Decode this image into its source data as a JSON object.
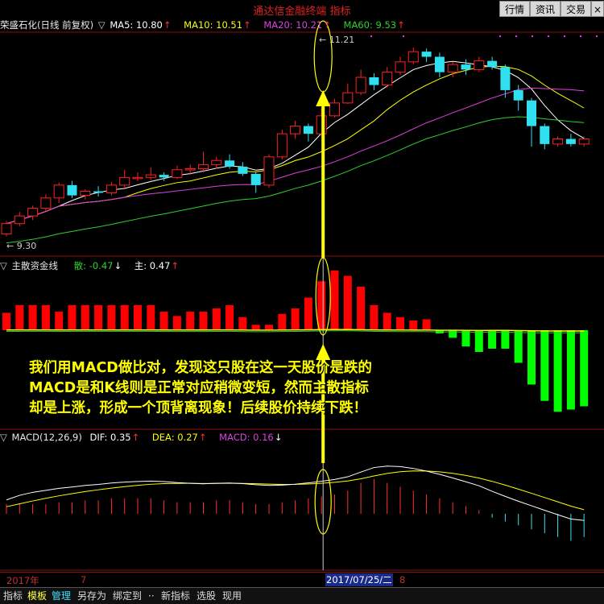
{
  "app": {
    "title": "通达信金融终端 指标"
  },
  "top_buttons": [
    "行情",
    "资讯",
    "交易"
  ],
  "panel_price": {
    "stock": "荣盛石化(日线 前复权)",
    "indicators": [
      {
        "label": "MA5: 10.80",
        "arrow": "↑",
        "color": "#ffffff"
      },
      {
        "label": "MA10: 10.51",
        "arrow": "↑",
        "color": "#ffff00"
      },
      {
        "label": "MA20: 10.21",
        "arrow": "↑",
        "color": "#e040e0"
      },
      {
        "label": "MA60: 9.53",
        "arrow": "↑",
        "color": "#30d030"
      }
    ],
    "high_label": "11.21",
    "low_label": "9.30"
  },
  "panel_fund": {
    "name": "主散资金线",
    "values": [
      {
        "label": "散: -0.47",
        "arrow": "↓",
        "color": "#30d030"
      },
      {
        "label": "主: 0.47",
        "arrow": "↑",
        "color": "#ffffff"
      }
    ]
  },
  "panel_macd": {
    "name": "MACD(12,26,9)",
    "values": [
      {
        "label": "DIF: 0.35",
        "arrow": "↑",
        "color": "#ffffff"
      },
      {
        "label": "DEA: 0.27",
        "arrow": "↑",
        "color": "#ffff00"
      },
      {
        "label": "MACD: 0.16",
        "arrow": "↓",
        "color": "#e040e0"
      }
    ]
  },
  "annotation": {
    "lines": [
      "我们用MACD做比对，发现这只股在这一天股价是跌的",
      "MACD是和K线则是正常对应稍微变短，然而主散指标",
      "却是上涨，形成一个顶背离现象！后续股价持续下跌！"
    ]
  },
  "timeline": {
    "year": "2017年",
    "m7": "7",
    "date": "2017/07/25/二",
    "m8": "8"
  },
  "bottom_tabs": [
    "指标",
    "模板",
    "管理",
    "另存为",
    "绑定到",
    "··",
    "新指标",
    "选股",
    "现用"
  ],
  "colors": {
    "up": "#ff2020",
    "down": "#30e0f0",
    "fund_up": "#ff0000",
    "fund_down": "#00ff00",
    "highlight": "#ffff00"
  },
  "chart_data": {
    "type": "candlestick",
    "candles": [
      {
        "o": 9.35,
        "c": 9.55,
        "h": 9.6,
        "l": 9.3
      },
      {
        "o": 9.55,
        "c": 9.7,
        "h": 9.78,
        "l": 9.5
      },
      {
        "o": 9.7,
        "c": 9.85,
        "h": 9.9,
        "l": 9.62
      },
      {
        "o": 9.85,
        "c": 10.05,
        "h": 10.12,
        "l": 9.8
      },
      {
        "o": 10.05,
        "c": 10.3,
        "h": 10.35,
        "l": 9.95
      },
      {
        "o": 10.3,
        "c": 10.1,
        "h": 10.38,
        "l": 10.05
      },
      {
        "o": 10.1,
        "c": 10.18,
        "h": 10.22,
        "l": 10.02
      },
      {
        "o": 10.18,
        "c": 10.15,
        "h": 10.28,
        "l": 10.08
      },
      {
        "o": 10.15,
        "c": 10.3,
        "h": 10.36,
        "l": 10.1
      },
      {
        "o": 10.3,
        "c": 10.45,
        "h": 10.6,
        "l": 10.25
      },
      {
        "o": 10.45,
        "c": 10.45,
        "h": 10.55,
        "l": 10.38
      },
      {
        "o": 10.45,
        "c": 10.5,
        "h": 10.65,
        "l": 10.4
      },
      {
        "o": 10.5,
        "c": 10.45,
        "h": 10.55,
        "l": 10.38
      },
      {
        "o": 10.45,
        "c": 10.6,
        "h": 10.68,
        "l": 10.42
      },
      {
        "o": 10.6,
        "c": 10.62,
        "h": 10.7,
        "l": 10.5
      },
      {
        "o": 10.62,
        "c": 10.7,
        "h": 10.95,
        "l": 10.55
      },
      {
        "o": 10.7,
        "c": 10.78,
        "h": 10.85,
        "l": 10.62
      },
      {
        "o": 10.78,
        "c": 10.66,
        "h": 10.9,
        "l": 10.62
      },
      {
        "o": 10.66,
        "c": 10.52,
        "h": 10.75,
        "l": 10.48
      },
      {
        "o": 10.52,
        "c": 10.3,
        "h": 10.55,
        "l": 10.15
      },
      {
        "o": 10.3,
        "c": 10.85,
        "h": 10.9,
        "l": 10.25
      },
      {
        "o": 10.85,
        "c": 11.3,
        "h": 11.38,
        "l": 10.8
      },
      {
        "o": 11.3,
        "c": 11.45,
        "h": 11.55,
        "l": 11.2
      },
      {
        "o": 11.45,
        "c": 11.3,
        "h": 11.5,
        "l": 11.15
      },
      {
        "o": 11.3,
        "c": 11.65,
        "h": 11.8,
        "l": 11.28
      },
      {
        "o": 11.65,
        "c": 11.9,
        "h": 11.98,
        "l": 11.62
      },
      {
        "o": 11.9,
        "c": 12.1,
        "h": 12.28,
        "l": 11.88
      },
      {
        "o": 12.1,
        "c": 12.4,
        "h": 12.55,
        "l": 12.05
      },
      {
        "o": 12.4,
        "c": 12.25,
        "h": 12.48,
        "l": 12.15
      },
      {
        "o": 12.25,
        "c": 12.5,
        "h": 12.6,
        "l": 12.2
      },
      {
        "o": 12.5,
        "c": 12.7,
        "h": 12.8,
        "l": 12.45
      },
      {
        "o": 12.7,
        "c": 12.9,
        "h": 12.98,
        "l": 12.65
      },
      {
        "o": 12.9,
        "c": 12.8,
        "h": 12.96,
        "l": 12.7
      },
      {
        "o": 12.8,
        "c": 12.5,
        "h": 12.88,
        "l": 12.4
      },
      {
        "o": 12.5,
        "c": 12.65,
        "h": 12.7,
        "l": 12.4
      },
      {
        "o": 12.65,
        "c": 12.55,
        "h": 12.75,
        "l": 12.45
      },
      {
        "o": 12.55,
        "c": 12.72,
        "h": 12.8,
        "l": 12.5
      },
      {
        "o": 12.72,
        "c": 12.6,
        "h": 12.8,
        "l": 12.55
      },
      {
        "o": 12.6,
        "c": 12.15,
        "h": 12.65,
        "l": 12.0
      },
      {
        "o": 12.15,
        "c": 11.95,
        "h": 12.25,
        "l": 11.75
      },
      {
        "o": 11.95,
        "c": 11.45,
        "h": 12.0,
        "l": 11.05
      },
      {
        "o": 11.45,
        "c": 11.1,
        "h": 11.5,
        "l": 11.0
      },
      {
        "o": 11.1,
        "c": 11.2,
        "h": 11.25,
        "l": 11.05
      },
      {
        "o": 11.2,
        "c": 11.1,
        "h": 11.3,
        "l": 11.05
      },
      {
        "o": 11.1,
        "c": 11.2,
        "h": 11.25,
        "l": 11.05
      }
    ],
    "fund_bars": [
      1.6,
      2.3,
      2.3,
      2.3,
      1.7,
      2.3,
      2.3,
      2.3,
      2.3,
      2.3,
      2.3,
      2.3,
      1.7,
      1.3,
      1.7,
      1.7,
      2.0,
      2.3,
      1.2,
      0.5,
      0.5,
      1.5,
      2.0,
      3.0,
      4.5,
      5.5,
      5.0,
      4.0,
      2.3,
      1.6,
      1.2,
      0.9,
      1.0,
      -0.3,
      -0.7,
      -1.5,
      -2.0,
      -1.7,
      -1.7,
      -3.0,
      -5.0,
      -6.5,
      -7.5,
      -7.3,
      -7.0
    ],
    "macd_bars": [
      0.05,
      0.05,
      0.05,
      0.05,
      0.06,
      0.06,
      0.07,
      0.07,
      0.08,
      0.08,
      0.08,
      0.08,
      0.07,
      0.06,
      0.06,
      0.06,
      0.07,
      0.07,
      0.06,
      0.05,
      0.05,
      0.06,
      0.07,
      0.08,
      0.09,
      0.1,
      0.12,
      0.16,
      0.18,
      0.16,
      0.14,
      0.12,
      0.1,
      0.08,
      0.06,
      0.04,
      0.02,
      -0.02,
      -0.04,
      -0.06,
      -0.08,
      -0.1,
      -0.12,
      -0.14,
      -0.12
    ]
  }
}
